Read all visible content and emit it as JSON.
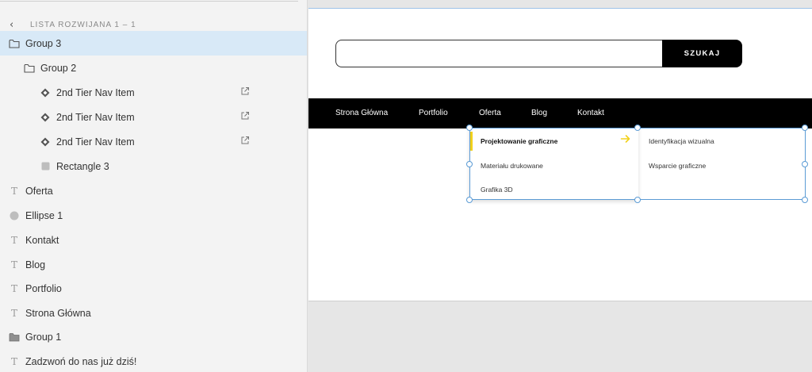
{
  "layers_panel": {
    "breadcrumb": "LISTA ROZWIJANA 1 – 1",
    "layers": [
      {
        "name": "Group 3",
        "icon": "folder-outline-icon",
        "indent": 0,
        "selected": true
      },
      {
        "name": "Group 2",
        "icon": "folder-outline-icon",
        "indent": 1
      },
      {
        "name": "2nd Tier Nav Item",
        "icon": "component-diamond-icon",
        "indent": 2,
        "external_link": true
      },
      {
        "name": "2nd Tier Nav Item",
        "icon": "component-diamond-icon",
        "indent": 2,
        "external_link": true
      },
      {
        "name": "2nd Tier Nav Item",
        "icon": "component-diamond-icon",
        "indent": 2,
        "external_link": true
      },
      {
        "name": "Rectangle 3",
        "icon": "rectangle-icon",
        "indent": 2
      },
      {
        "name": "Oferta",
        "icon": "text-icon",
        "indent": 0
      },
      {
        "name": "Ellipse 1",
        "icon": "ellipse-icon",
        "indent": 0
      },
      {
        "name": "Kontakt",
        "icon": "text-icon",
        "indent": 0
      },
      {
        "name": "Blog",
        "icon": "text-icon",
        "indent": 0
      },
      {
        "name": "Portfolio",
        "icon": "text-icon",
        "indent": 0
      },
      {
        "name": "Strona Główna",
        "icon": "text-icon",
        "indent": 0
      },
      {
        "name": "Group 1",
        "icon": "folder-filled-icon",
        "indent": 0
      },
      {
        "name": "Zadzwoń do nas już dziś!",
        "icon": "text-icon",
        "indent": 0
      }
    ]
  },
  "canvas": {
    "search": {
      "value": "",
      "button_label": "SZUKAJ"
    },
    "nav": [
      "Strona Główna",
      "Portfolio",
      "Oferta",
      "Blog",
      "Kontakt"
    ],
    "dropdown": {
      "items": [
        "Projektowanie graficzne",
        "Materiału drukowane",
        "Grafika 3D"
      ],
      "active_index": 0,
      "submenu": [
        "Identyfikacja wizualna",
        "Wsparcie graficzne"
      ]
    },
    "colors": {
      "accent": "#f2d11b",
      "selection": "#5b9bd5",
      "navbar": "#000000",
      "selected_layer": "#d8e9f7"
    }
  }
}
